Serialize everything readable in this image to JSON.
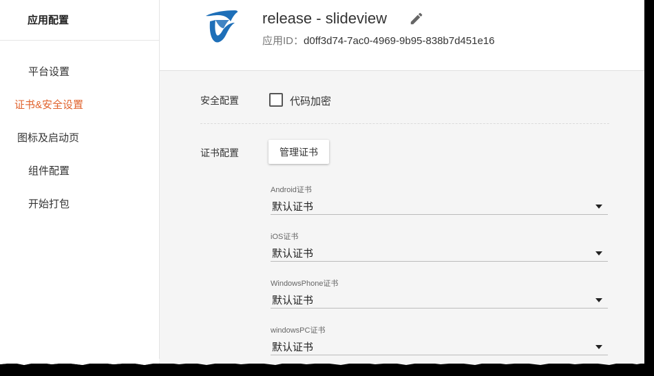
{
  "sidebar": {
    "title": "应用配置",
    "items": [
      {
        "label": "平台设置",
        "active": false
      },
      {
        "label": "证书&安全设置",
        "active": true
      },
      {
        "label": "图标及启动页",
        "active": false
      },
      {
        "label": "组件配置",
        "active": false
      },
      {
        "label": "开始打包",
        "active": false
      }
    ]
  },
  "header": {
    "title": "release - slideview",
    "app_id_label": "应用ID：",
    "app_id": "d0ff3d74-7ac0-4969-9b95-838b7d451e16",
    "logo_icon": "app-logo-icon",
    "edit_icon": "pencil-icon"
  },
  "security": {
    "label": "安全配置",
    "code_encrypt_label": "代码加密",
    "code_encrypt_checked": false
  },
  "certs": {
    "label": "证书配置",
    "manage_button": "管理证书",
    "selects": [
      {
        "label": "Android证书",
        "value": "默认证书"
      },
      {
        "label": "iOS证书",
        "value": "默认证书"
      },
      {
        "label": "WindowsPhone证书",
        "value": "默认证书"
      },
      {
        "label": "windowsPC证书",
        "value": "默认证书"
      }
    ]
  },
  "colors": {
    "active": "#e0622c",
    "logo": "#1e6fb8"
  }
}
